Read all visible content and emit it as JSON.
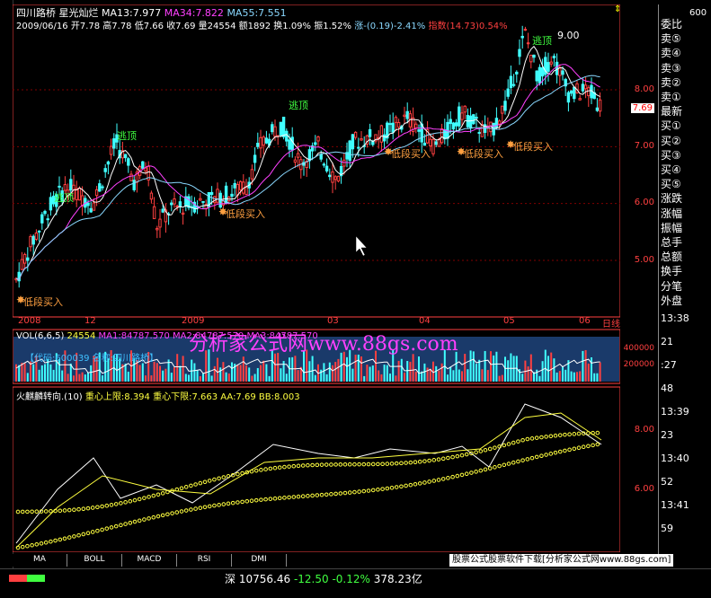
{
  "header": {
    "stock_name": "四川路桥",
    "indicator_name": "星光灿烂",
    "ma13_label": "MA13:7.977",
    "ma34_label": "MA34:7.822",
    "ma55_label": "MA55:7.551"
  },
  "quote": {
    "date": "2009/06/16",
    "open": "开7.78",
    "high": "高7.78",
    "low": "低7.66",
    "close": "收7.69",
    "volume": "量24554",
    "amount": "额1892",
    "turnover": "换1.09%",
    "amplitude": "振1.52%",
    "change": "涨-(0.19)-2.41%",
    "index": "指数(14.73)0.54%"
  },
  "price_axis": [
    "8.00",
    "7.00",
    "6.00",
    "5.00"
  ],
  "current_price": "7.69",
  "top_right_value": "600",
  "annotations": {
    "escape_top": "逃顶",
    "low_buy": "低段买入",
    "high_value": "9.00"
  },
  "months": [
    "2008",
    "12",
    "2009",
    "03",
    "04",
    "05",
    "06"
  ],
  "month_tag": "日线",
  "volume_panel": {
    "title": "VOL(6,6,5)",
    "value": "24554",
    "ma1": "MA1:84787.570",
    "ma2": "MA2:84787.570",
    "ma3": "MA3:84787.570",
    "code_line": "【代码:600039 名称:四川路桥】",
    "axis": [
      "400000",
      "200000"
    ]
  },
  "indicator_panel": {
    "title": "火麒麟转向.(10)",
    "upper": "重心上限:8.394",
    "lower": "重心下限:7.663",
    "aa": "AA:7.69",
    "bb": "BB:8.003",
    "axis": [
      "8.00",
      "6.00"
    ]
  },
  "watermark": "分析家公式网www.88gs.com",
  "side_panel": {
    "items": [
      "委比",
      "卖⑤",
      "卖④",
      "卖③",
      "卖②",
      "卖①",
      "最新",
      "买①",
      "买②",
      "买③",
      "买④",
      "买⑤",
      "涨跌",
      "涨幅",
      "振幅",
      "总手",
      "总额",
      "换手",
      "分笔",
      "外盘"
    ],
    "times": [
      "13:38",
      "21",
      ":27",
      "48",
      "13:39",
      "23",
      "13:40",
      "52",
      "13:41",
      "59"
    ]
  },
  "tabs": [
    "MA",
    "BOLL",
    "MACD",
    "RSI",
    "DMI"
  ],
  "ad_text": "股票公式股票软件下载[分析家公式网www.88gs.com]",
  "status": {
    "market": "深",
    "index_value": "10756.46",
    "change": "-12.50",
    "pct": "-0.12%",
    "amount": "378.23亿"
  },
  "colors": {
    "ma13": "#ffffff",
    "ma34": "#ff40ff",
    "ma55": "#8ad8ff",
    "up": "#ff4040",
    "down": "#40ffff",
    "escape_label": "#40ff40",
    "buy_label": "#ffa040",
    "indicator_yellow": "#ffff40"
  }
}
